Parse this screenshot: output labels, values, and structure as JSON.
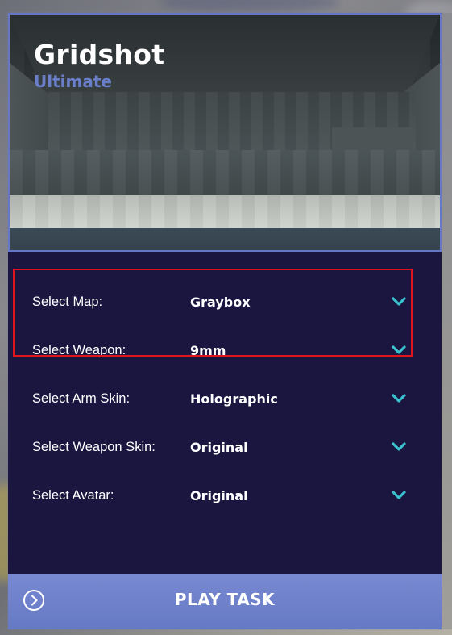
{
  "hero": {
    "title": "Gridshot",
    "subtitle": "Ultimate",
    "subtitle_color": "#6a7ec9"
  },
  "options": [
    {
      "label": "Select Map:",
      "value": "Graybox",
      "icon": "chevron-down-icon"
    },
    {
      "label": "Select Weapon:",
      "value": "9mm",
      "icon": "chevron-down-icon"
    },
    {
      "label": "Select Arm Skin:",
      "value": "Holographic",
      "icon": "chevron-down-icon"
    },
    {
      "label": "Select Weapon Skin:",
      "value": "Original",
      "icon": "chevron-down-icon"
    },
    {
      "label": "Select Avatar:",
      "value": "Original",
      "icon": "chevron-down-icon"
    }
  ],
  "play": {
    "label": "PLAY TASK",
    "icon": "chevron-right-circle-icon"
  },
  "colors": {
    "panel_bg": "#1b1640",
    "accent": "#6a7ec9",
    "chevron": "#39c3cf",
    "highlight_border": "#e0141c"
  }
}
